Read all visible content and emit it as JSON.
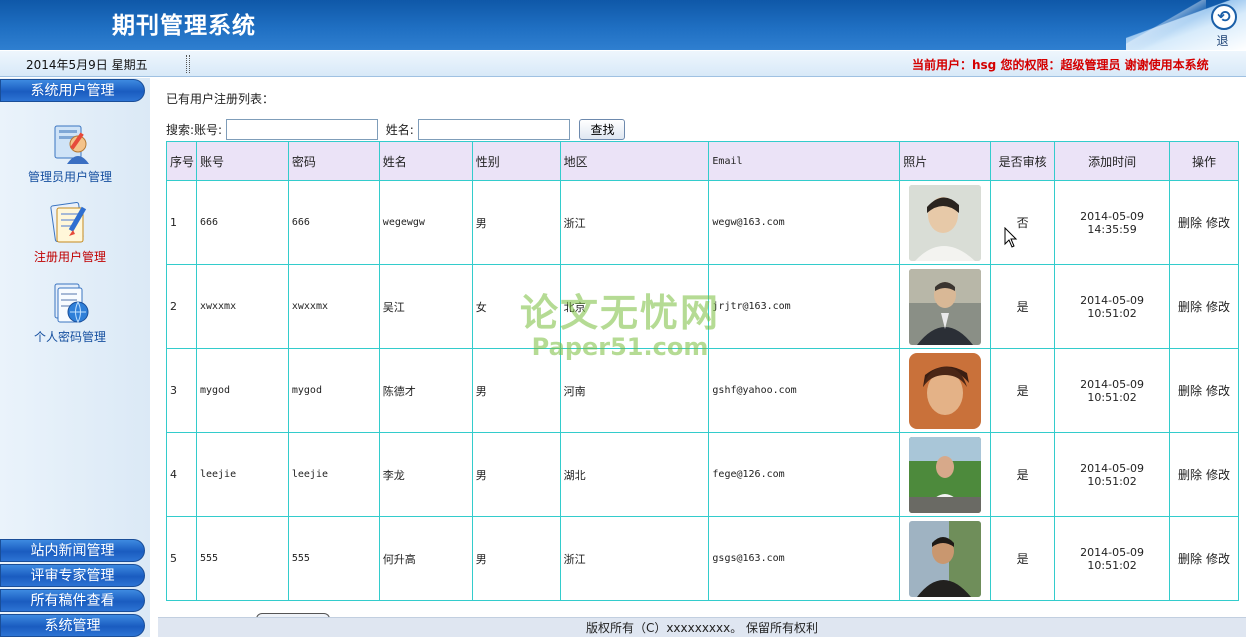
{
  "header": {
    "title": "期刊管理系统",
    "exit_label": "退 出",
    "date": "2014年5月9日 星期五",
    "user_info": "当前用户：hsg 您的权限：超级管理员 谢谢使用本系统"
  },
  "sidebar": {
    "top_button": "系统用户管理",
    "items": [
      {
        "label": "管理员用户管理",
        "icon": "admin-user-icon"
      },
      {
        "label": "注册用户管理",
        "icon": "registered-user-icon"
      },
      {
        "label": "个人密码管理",
        "icon": "password-icon"
      }
    ],
    "bottom_buttons": [
      "站内新闻管理",
      "评审专家管理",
      "所有稿件查看",
      "系统管理"
    ]
  },
  "main": {
    "caption": "已有用户注册列表：",
    "search": {
      "account_label": "搜索:账号:",
      "name_label": "姓名:",
      "account_value": "",
      "name_value": "",
      "button": "查找"
    },
    "columns": [
      "序号",
      "账号",
      "密码",
      "姓名",
      "性别",
      "地区",
      "Email",
      "照片",
      "是否审核",
      "添加时间",
      "操作"
    ],
    "rows": [
      {
        "no": "1",
        "account": "666",
        "password": "666",
        "name": "wegewgw",
        "gender": "男",
        "region": "浙江",
        "email": "wegw@163.com",
        "approved": "否",
        "date": "2014-05-09",
        "time": "14:35:59",
        "photo": "young-man-photo"
      },
      {
        "no": "2",
        "account": "xwxxmx",
        "password": "xwxxmx",
        "name": "吴江",
        "gender": "女",
        "region": "北京",
        "email": "jrjtr@163.com",
        "approved": "是",
        "date": "2014-05-09",
        "time": "10:51:02",
        "photo": "man-in-suit-photo"
      },
      {
        "no": "3",
        "account": "mygod",
        "password": "mygod",
        "name": "陈德才",
        "gender": "男",
        "region": "河南",
        "email": "gshf@yahoo.com",
        "approved": "是",
        "date": "2014-05-09",
        "time": "10:51:02",
        "photo": "young-man-portrait-photo"
      },
      {
        "no": "4",
        "account": "leejie",
        "password": "leejie",
        "name": "李龙",
        "gender": "男",
        "region": "湖北",
        "email": "fege@126.com",
        "approved": "是",
        "date": "2014-05-09",
        "time": "10:51:02",
        "photo": "man-outdoors-photo"
      },
      {
        "no": "5",
        "account": "555",
        "password": "555",
        "name": "何升高",
        "gender": "男",
        "region": "浙江",
        "email": "gsgs@163.com",
        "approved": "是",
        "date": "2014-05-09",
        "time": "10:51:02",
        "photo": "man-outdoors-photo-2"
      }
    ],
    "ops": {
      "delete": "删除",
      "edit": "修改"
    }
  },
  "watermark": {
    "line1": "论文无忧网",
    "line2": "Paper51.com"
  },
  "footer": {
    "text": "版权所有（C）xxxxxxxxx。 保留所有权利"
  }
}
